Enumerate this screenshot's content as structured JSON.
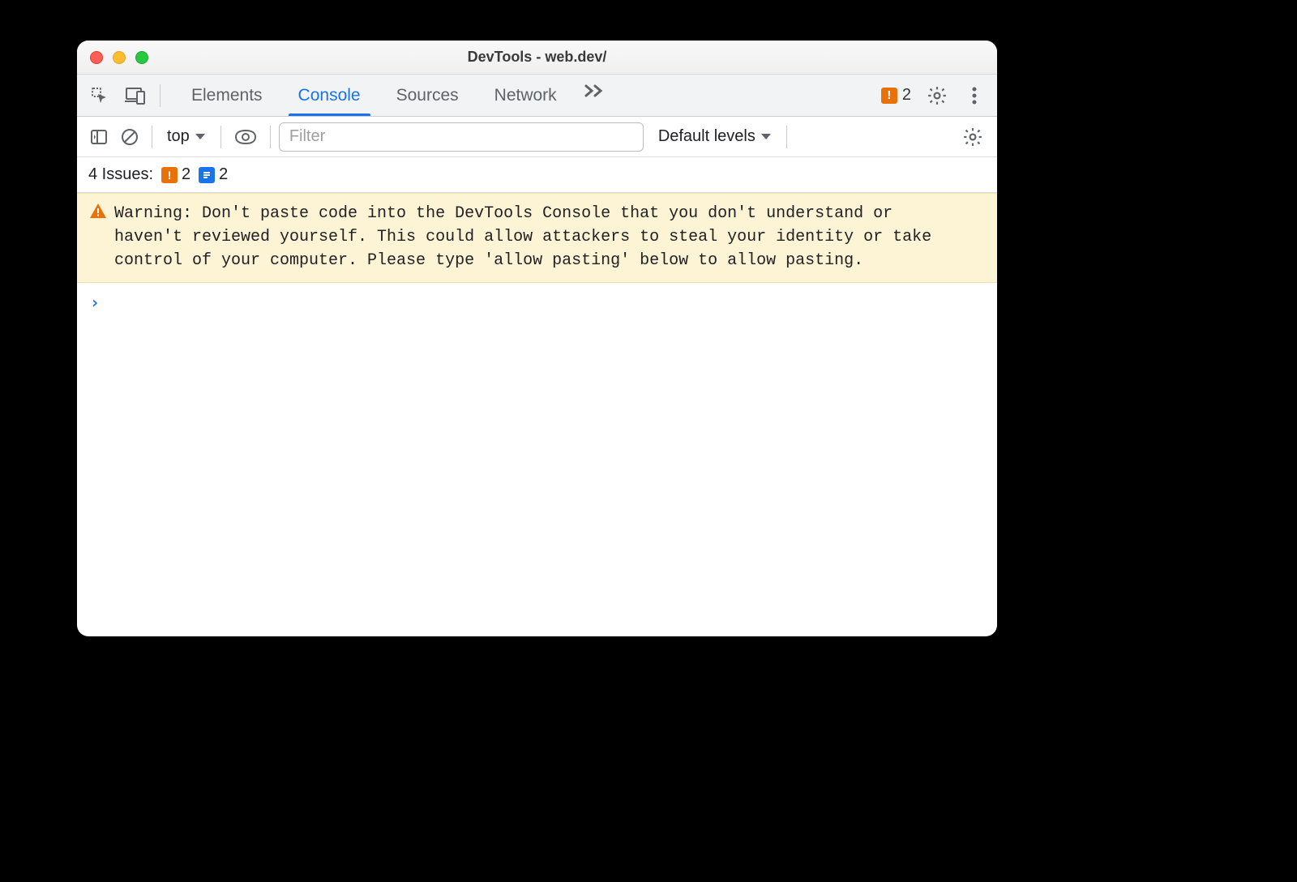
{
  "window": {
    "title": "DevTools - web.dev/"
  },
  "tabstrip": {
    "tabs": [
      "Elements",
      "Console",
      "Sources",
      "Network"
    ],
    "active_index": 1,
    "error_count": "2"
  },
  "console_toolbar": {
    "context": "top",
    "filter_placeholder": "Filter",
    "levels_label": "Default levels"
  },
  "issues": {
    "label": "4 Issues:",
    "orange_count": "2",
    "blue_count": "2"
  },
  "warning": {
    "text": "Warning: Don't paste code into the DevTools Console that you don't understand or haven't reviewed yourself. This could allow attackers to steal your identity or take control of your computer. Please type 'allow pasting' below to allow pasting."
  },
  "prompt": {
    "marker": "›"
  }
}
